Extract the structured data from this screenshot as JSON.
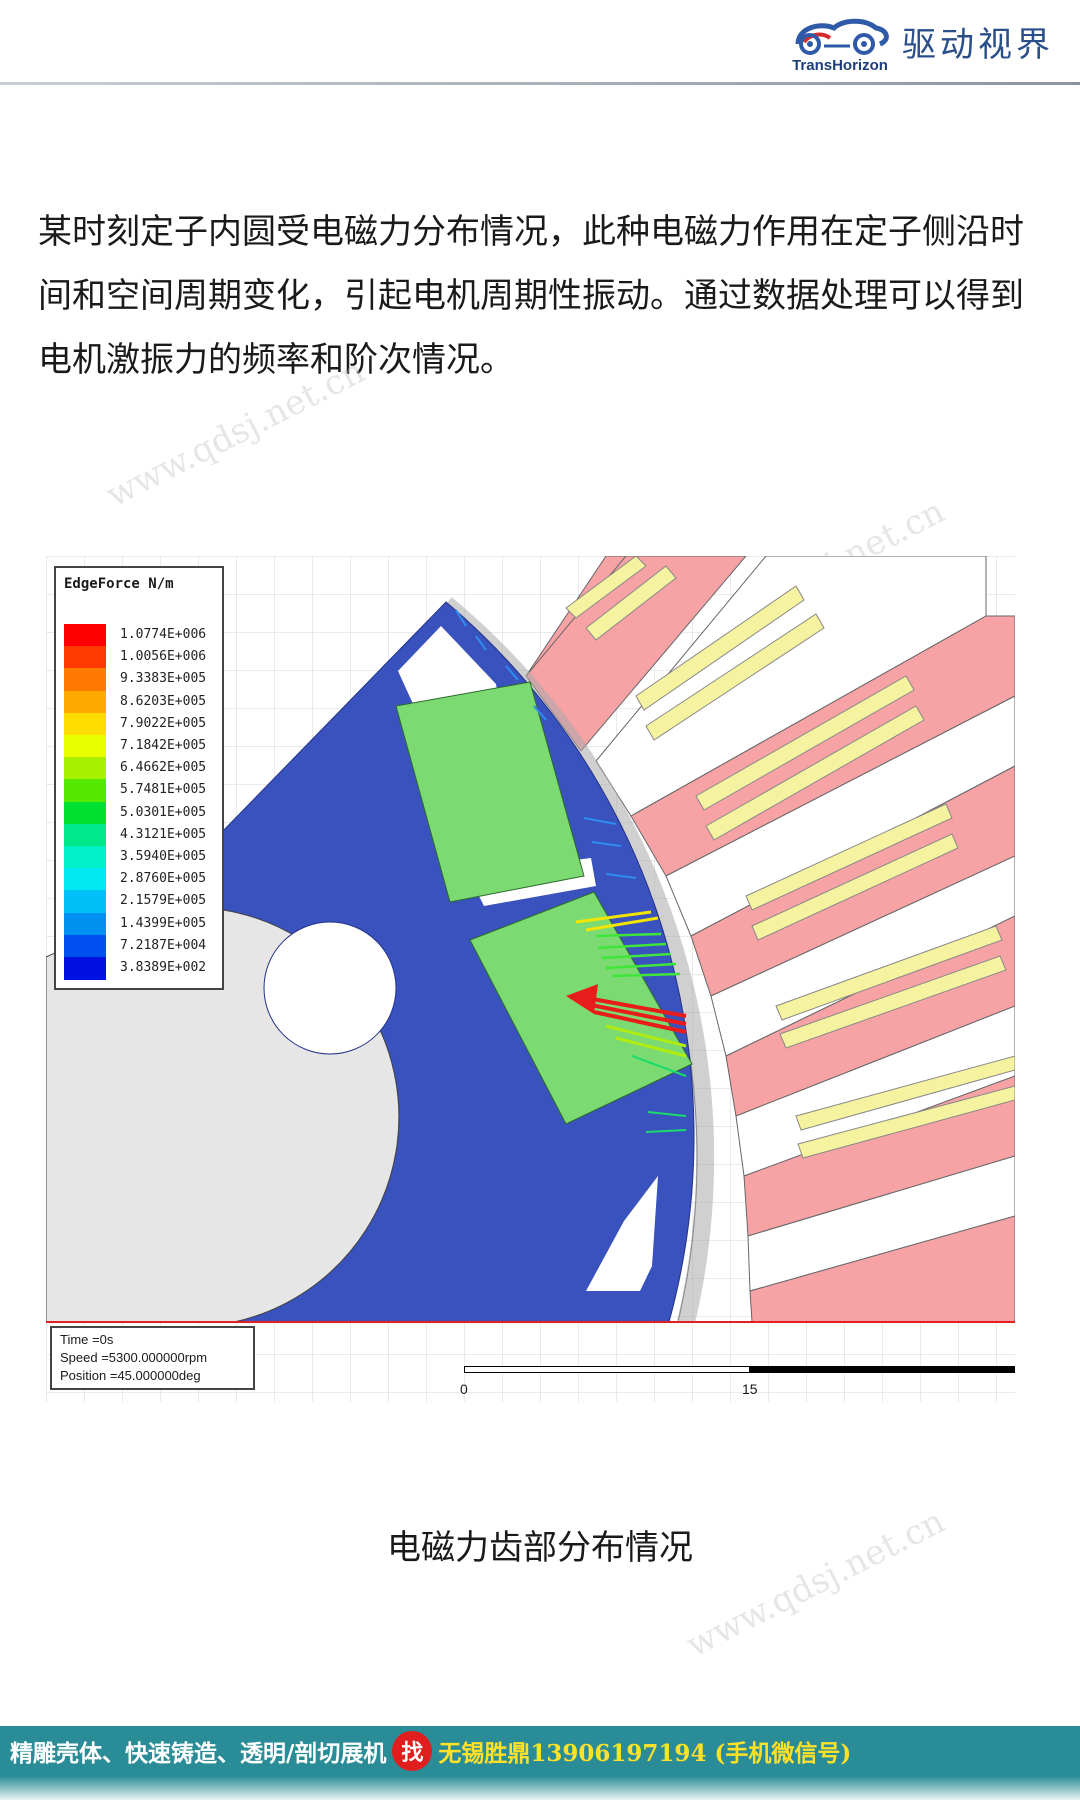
{
  "header": {
    "brand_en": "TransHorizon",
    "brand_cn": "驱动视界"
  },
  "intro": {
    "text": "某时刻定子内圆受电磁力分布情况，此种电磁力作用在定子侧沿时间和空间周期变化，引起电机周期性振动。通过数据处理可以得到电机激振力的频率和阶次情况。"
  },
  "watermark": {
    "text": "www.qdsj.net.cn"
  },
  "legend": {
    "title": "EdgeForce N/m",
    "entries": [
      {
        "value": "1.0774E+006",
        "color": "#ff0000"
      },
      {
        "value": "1.0056E+006",
        "color": "#ff3a00"
      },
      {
        "value": "9.3383E+005",
        "color": "#ff7a00"
      },
      {
        "value": "8.6203E+005",
        "color": "#ffaa00"
      },
      {
        "value": "7.9022E+005",
        "color": "#ffdd00"
      },
      {
        "value": "7.1842E+005",
        "color": "#e8ff00"
      },
      {
        "value": "6.4662E+005",
        "color": "#a8f000"
      },
      {
        "value": "5.7481E+005",
        "color": "#55e800"
      },
      {
        "value": "5.0301E+005",
        "color": "#00e030"
      },
      {
        "value": "4.3121E+005",
        "color": "#00e88a"
      },
      {
        "value": "3.5940E+005",
        "color": "#00f0c8"
      },
      {
        "value": "2.8760E+005",
        "color": "#00e8f0"
      },
      {
        "value": "2.1579E+005",
        "color": "#00c0f8"
      },
      {
        "value": "1.4399E+005",
        "color": "#0090f0"
      },
      {
        "value": "7.2187E+004",
        "color": "#0050f0"
      },
      {
        "value": "3.8389E+002",
        "color": "#0010e0"
      }
    ]
  },
  "info": {
    "time": "Time    =0s",
    "speed": "Speed   =5300.000000rpm",
    "position": "Position =45.000000deg"
  },
  "scale": {
    "start": "0",
    "mid": "15"
  },
  "caption": "电磁力齿部分布情况",
  "footer": {
    "left": "精雕壳体、快速铸造、透明/剖切展机",
    "badge": "找",
    "right": "无锡胜鼎13906197194 (手机微信号)"
  },
  "colors": {
    "rotor_core": "#3a52bd",
    "magnet": "#7cda72",
    "stator": "#f7a3a6",
    "winding": "#f6f3a0",
    "shaft": "#e6e6e6",
    "footer_bg": "#2a8c96",
    "footer_highlight": "#ffe12a"
  }
}
